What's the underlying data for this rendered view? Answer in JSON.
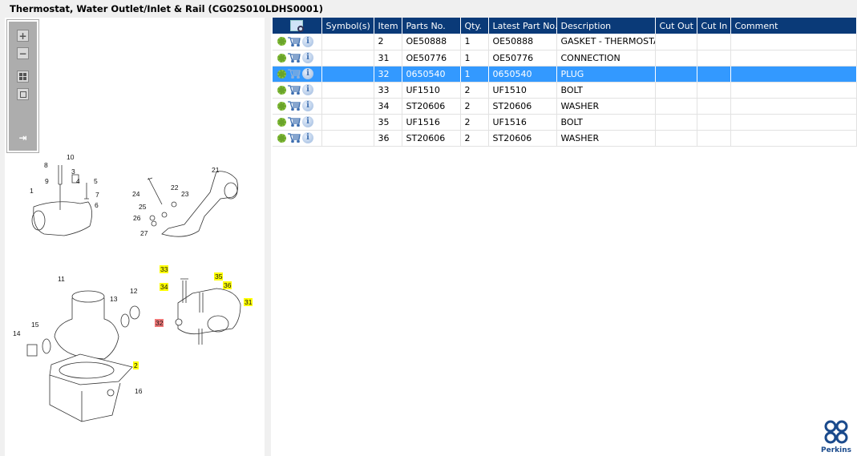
{
  "title": "Thermostat, Water Outlet/Inlet & Rail (CG02S010LDHS0001)",
  "toolbar": {
    "zoom_in": "+",
    "zoom_out": "−"
  },
  "table": {
    "headers": [
      "",
      "Symbol(s)",
      "Item",
      "Parts No.",
      "Qty.",
      "Latest Part No.",
      "Description",
      "Cut Out",
      "Cut In",
      "Comment"
    ],
    "rows": [
      {
        "symbols": "",
        "item": "2",
        "part": "OE50888",
        "qty": "1",
        "latest": "OE50888",
        "desc": "GASKET - THERMOSTAT",
        "cut_out": "",
        "cut_in": "",
        "comment": ""
      },
      {
        "symbols": "",
        "item": "31",
        "part": "OE50776",
        "qty": "1",
        "latest": "OE50776",
        "desc": "CONNECTION",
        "cut_out": "",
        "cut_in": "",
        "comment": ""
      },
      {
        "symbols": "",
        "item": "32",
        "part": "0650540",
        "qty": "1",
        "latest": "0650540",
        "desc": "PLUG",
        "cut_out": "",
        "cut_in": "",
        "comment": "",
        "selected": true
      },
      {
        "symbols": "",
        "item": "33",
        "part": "UF1510",
        "qty": "2",
        "latest": "UF1510",
        "desc": "BOLT",
        "cut_out": "",
        "cut_in": "",
        "comment": ""
      },
      {
        "symbols": "",
        "item": "34",
        "part": "ST20606",
        "qty": "2",
        "latest": "ST20606",
        "desc": "WASHER",
        "cut_out": "",
        "cut_in": "",
        "comment": ""
      },
      {
        "symbols": "",
        "item": "35",
        "part": "UF1516",
        "qty": "2",
        "latest": "UF1516",
        "desc": "BOLT",
        "cut_out": "",
        "cut_in": "",
        "comment": ""
      },
      {
        "symbols": "",
        "item": "36",
        "part": "ST20606",
        "qty": "2",
        "latest": "ST20606",
        "desc": "WASHER",
        "cut_out": "",
        "cut_in": "",
        "comment": ""
      }
    ],
    "info_glyph": "i"
  },
  "diagram": {
    "callouts": [
      "10",
      "8",
      "9",
      "3",
      "4",
      "5",
      "7",
      "6",
      "1",
      "21",
      "24",
      "22",
      "23",
      "25",
      "26",
      "27",
      "33",
      "34",
      "35",
      "36",
      "31",
      "32",
      "11",
      "12",
      "13",
      "15",
      "14",
      "2",
      "16"
    ],
    "highlight_color": "#ffff00",
    "selected_color": "#f07878"
  },
  "logo": {
    "text": "Perkins",
    "color": "#1a4a8c"
  },
  "colors": {
    "header": "#0a3a78",
    "selected_row": "#3399ff"
  }
}
